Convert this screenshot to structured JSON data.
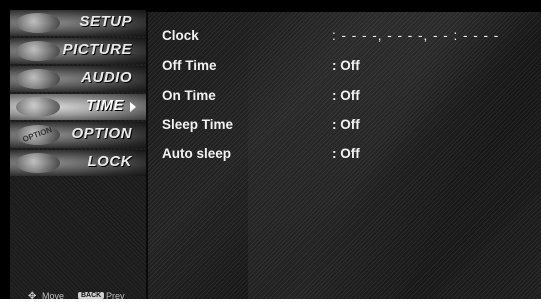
{
  "menu": {
    "items": [
      {
        "label": "SETUP"
      },
      {
        "label": "PICTURE"
      },
      {
        "label": "AUDIO"
      },
      {
        "label": "TIME"
      },
      {
        "label": "OPTION"
      },
      {
        "label": "LOCK"
      }
    ],
    "active_item": "TIME"
  },
  "hints": {
    "move_label": "Move",
    "back_key": "BACK",
    "prev_label": "Prev"
  },
  "settings": [
    {
      "label": "Clock",
      "value": ": - -  - -, - - - -, - - : - -  - -"
    },
    {
      "label": "Off Time",
      "value": ": Off"
    },
    {
      "label": "On Time",
      "value": ": Off"
    },
    {
      "label": "Sleep Time",
      "value": ": Off"
    },
    {
      "label": "Auto sleep",
      "value": ": Off"
    }
  ],
  "thumb_text": "OPTION",
  "colors": {
    "background": "#000000",
    "text": "#f2f2f2",
    "active_highlight": "#d8d8d8"
  }
}
